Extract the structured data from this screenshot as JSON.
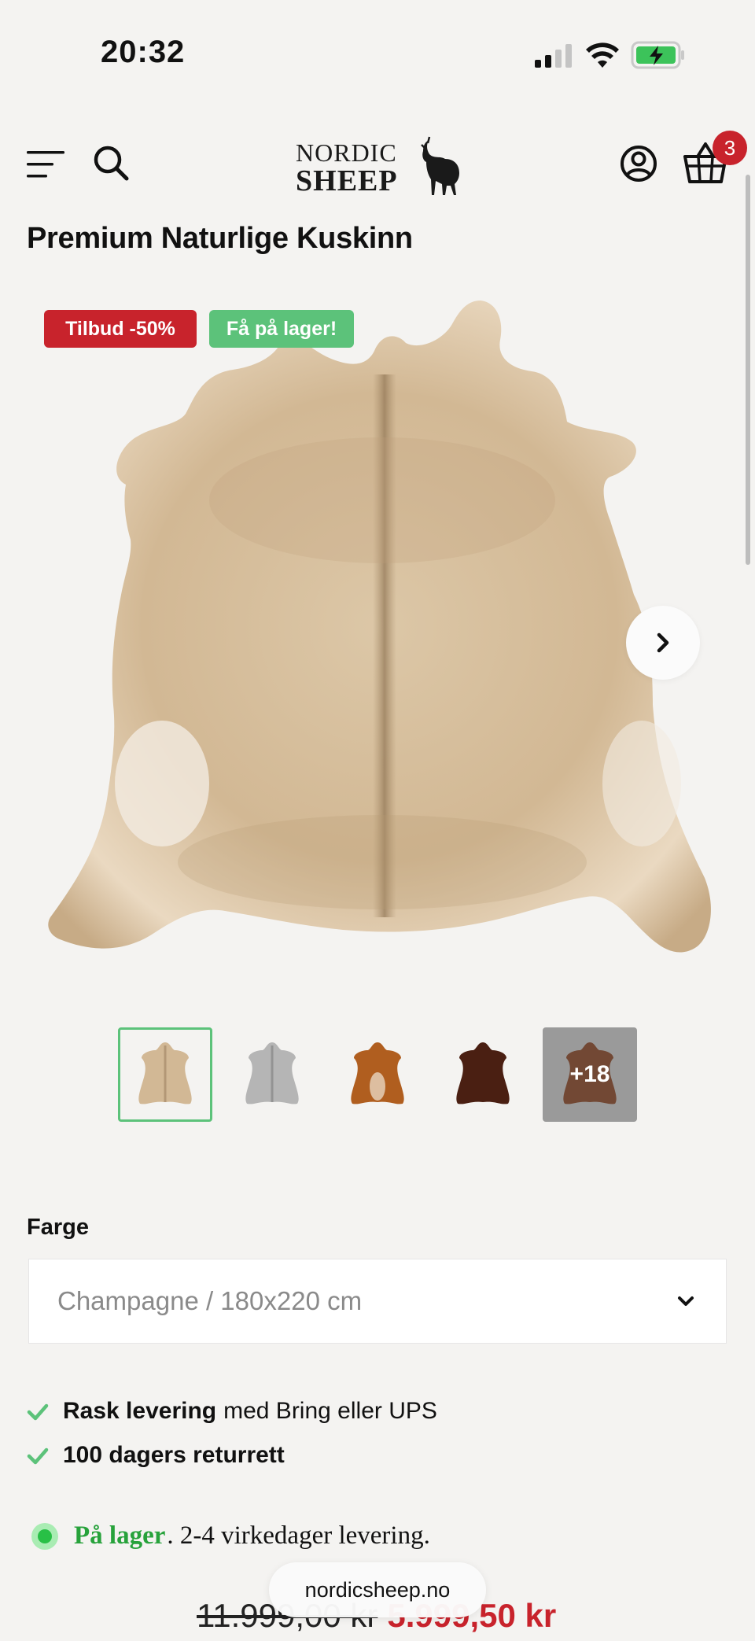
{
  "status_bar": {
    "time": "20:32"
  },
  "header": {
    "logo_top": "NORDIC",
    "logo_bottom": "SHEEP",
    "cart_count": "3"
  },
  "product": {
    "title": "Premium Naturlige Kuskinn",
    "badges": {
      "sale": "Tilbud -50%",
      "stock": "Få på lager!"
    },
    "thumbnails": [
      {
        "name": "champagne",
        "color": "#d2b895"
      },
      {
        "name": "grey",
        "color": "#b5b5b5"
      },
      {
        "name": "brown-white",
        "color": "#b05e1f"
      },
      {
        "name": "dark-brown",
        "color": "#4a1f12"
      }
    ],
    "more_images_label": "+18"
  },
  "variant": {
    "label": "Farge",
    "selected": "Champagne / 180x220 cm"
  },
  "usps": [
    {
      "strong": "Rask levering",
      "rest": "med Bring eller UPS"
    },
    {
      "strong": "100 dagers returrett",
      "rest": ""
    }
  ],
  "availability": {
    "strong": "På lager",
    "rest": ". 2-4 virkedager levering."
  },
  "price": {
    "old": "11.999,00 kr",
    "new": "5.999,50 kr"
  },
  "browser": {
    "url": "nordicsheep.no"
  },
  "colors": {
    "accent_red": "#c8232c",
    "accent_green": "#5cc27a"
  }
}
